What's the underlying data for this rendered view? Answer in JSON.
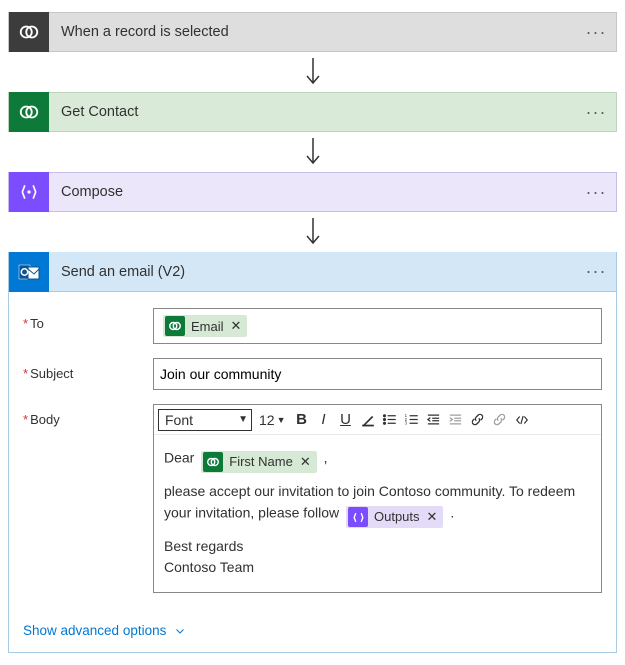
{
  "steps": {
    "trigger": {
      "title": "When a record is selected"
    },
    "getContact": {
      "title": "Get Contact"
    },
    "compose": {
      "title": "Compose"
    },
    "email": {
      "title": "Send an email (V2)"
    }
  },
  "fields": {
    "to": {
      "label": "To",
      "token": "Email"
    },
    "subject": {
      "label": "Subject",
      "value": "Join our community"
    },
    "body": {
      "label": "Body"
    }
  },
  "bodyContent": {
    "greeting": "Dear",
    "firstNameToken": "First Name",
    "line1": "please accept our invitation to join Contoso community. To redeem your invitation, please follow",
    "outputsToken": "Outputs",
    "signoff1": "Best regards",
    "signoff2": "Contoso Team"
  },
  "toolbar": {
    "fontLabel": "Font",
    "size": "12"
  },
  "advanced": "Show advanced options"
}
